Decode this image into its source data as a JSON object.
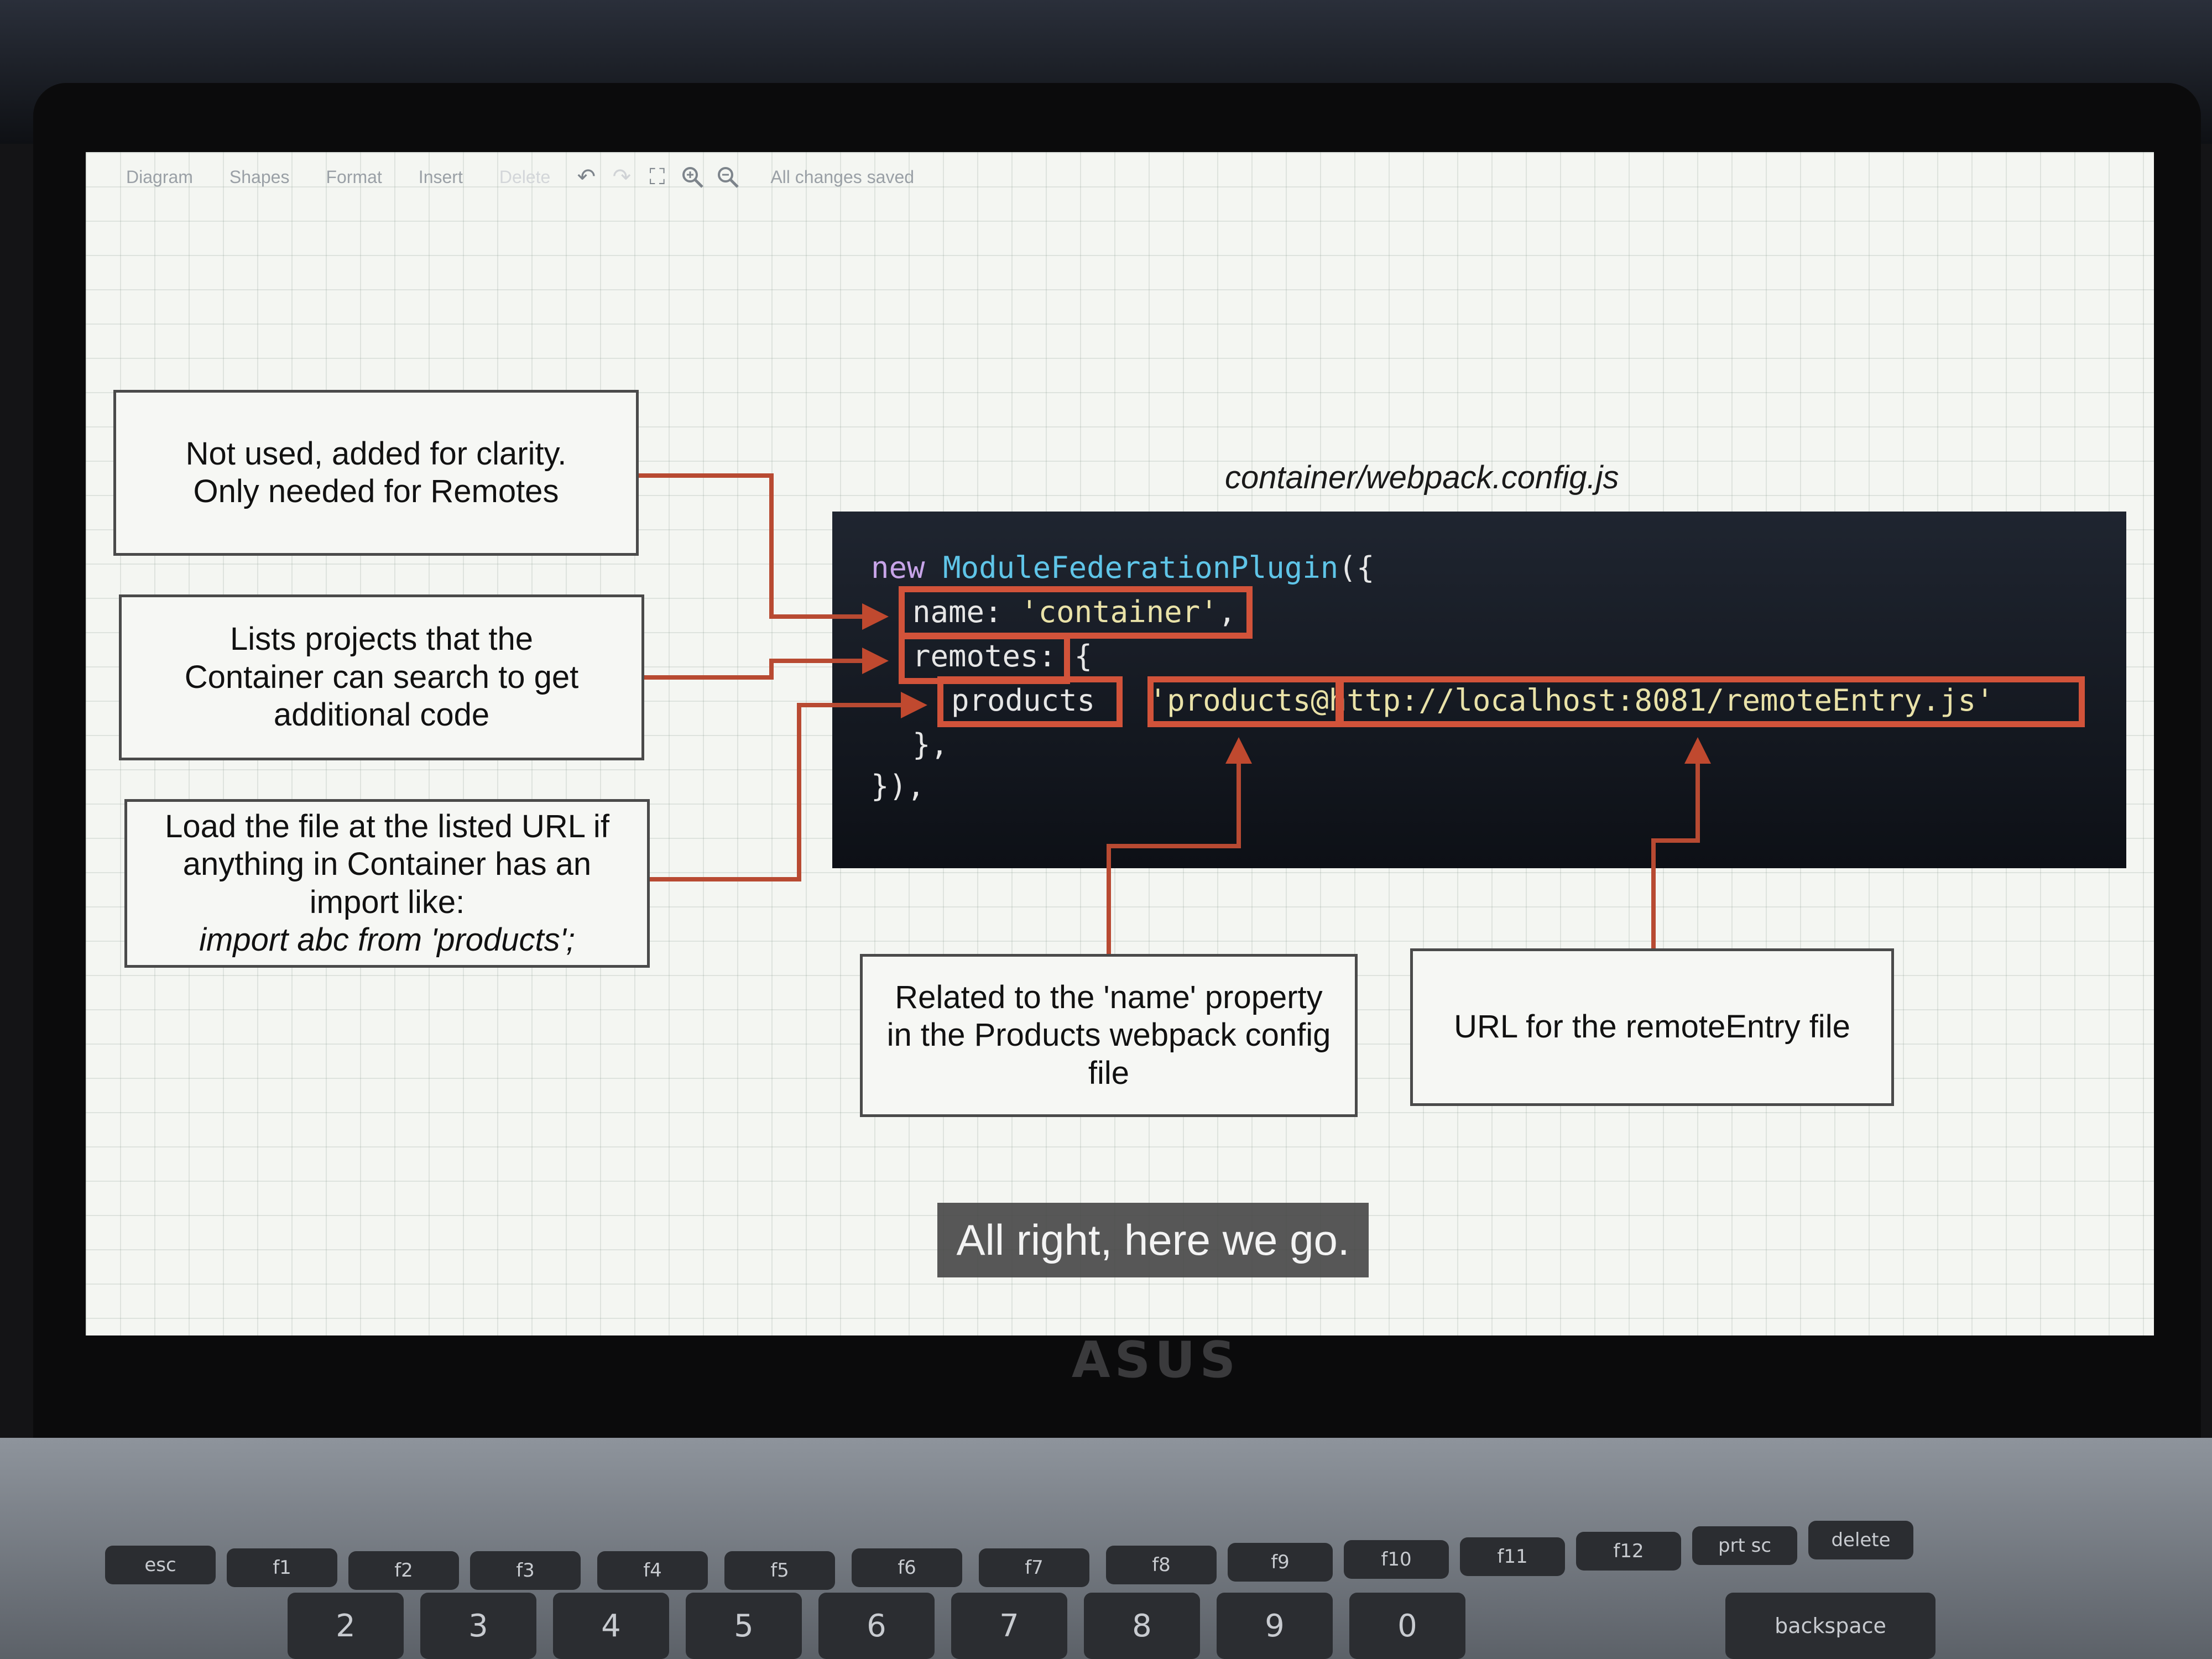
{
  "toolbar": {
    "menu_diagram": "Diagram",
    "menu_shapes": "Shapes",
    "menu_format": "Format",
    "insert_label": "Insert",
    "delete_label": "Delete",
    "undo_icon": "undo-icon",
    "redo_icon": "redo-icon",
    "fullscreen_icon": "fullscreen-icon",
    "zoom_in_icon": "zoom-in-icon",
    "zoom_out_icon": "zoom-out-icon",
    "status": "All changes saved"
  },
  "diagram": {
    "file_title": "container/webpack.config.js",
    "notes": {
      "name_note": [
        "Not used, added for clarity.",
        "Only needed for Remotes"
      ],
      "remotes_note": [
        "Lists projects that the",
        "Container can search to get",
        "additional code"
      ],
      "products_note": [
        "Load the file at the listed URL if",
        "anything in Container has an",
        "import like:",
        "import abc from 'products';"
      ],
      "name_relation_note": [
        "Related to the 'name' property",
        "in the Products webpack config",
        "file"
      ],
      "url_note": "URL for the remoteEntry file"
    },
    "code": {
      "line1_kw": "new",
      "line1_cls": "ModuleFederationPlugin",
      "line1_rest": "({",
      "line2_key": "name:",
      "line2_val": "'container'",
      "line2_rest": ",",
      "line3_key": "remotes:",
      "line3_rest": "{",
      "line4_key": "products",
      "line4_val1": "'products",
      "line4_val2": "@http://localhost:8081/remoteEntry.js'",
      "line5": "},",
      "line6": "}),"
    },
    "highlight_color": "#d2533a"
  },
  "caption": "All right, here we go.",
  "laptop": {
    "brand": "ASUS",
    "fn_keys": [
      "esc",
      "f1",
      "f2",
      "f3",
      "f4",
      "f5",
      "f6",
      "f7",
      "f8",
      "f9",
      "f10",
      "f11",
      "f12",
      "prt sc",
      "delete"
    ],
    "num_keys": [
      "2",
      "3",
      "4",
      "5",
      "6",
      "7",
      "8",
      "9",
      "0",
      "backspace"
    ]
  }
}
